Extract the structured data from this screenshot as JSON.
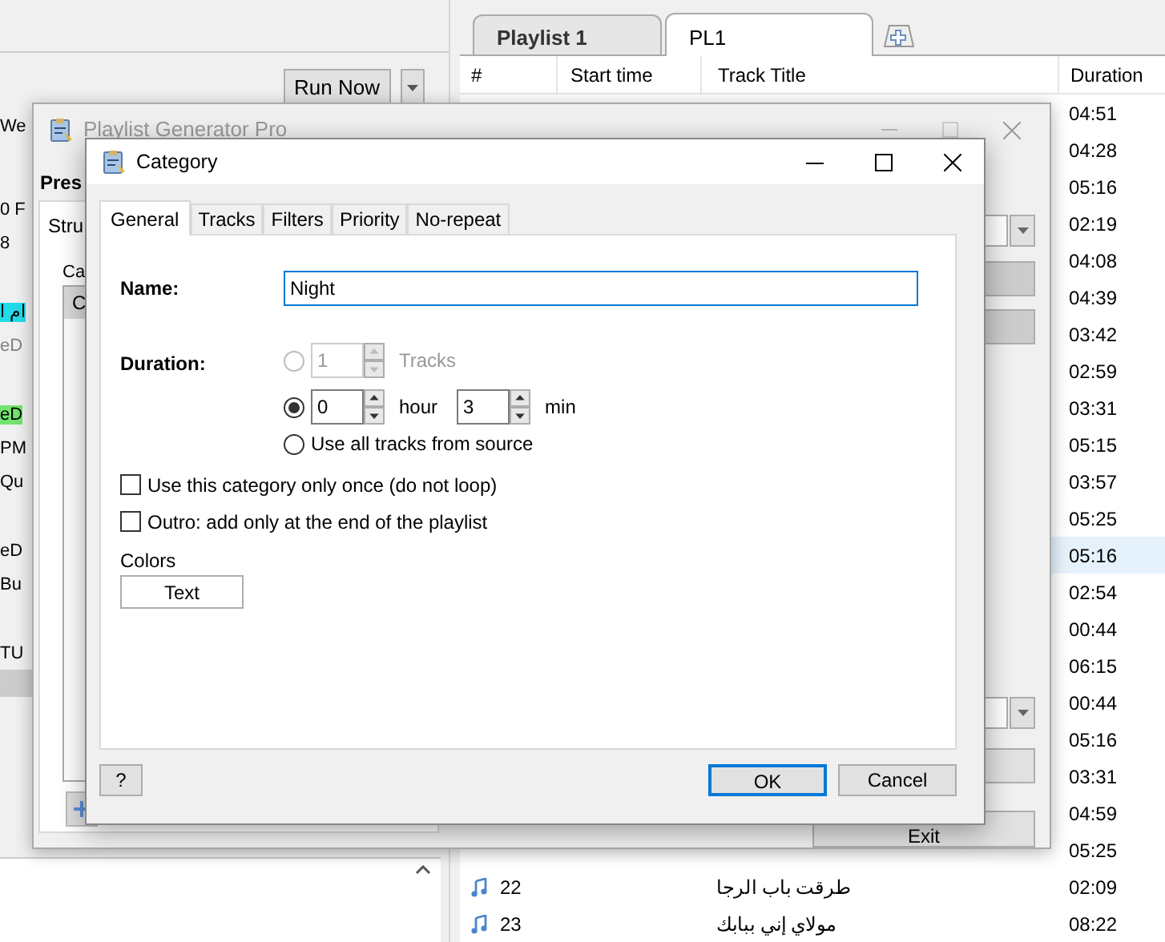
{
  "background": {
    "run_button": "Run Now",
    "left_top_text": "We",
    "left_rows": [
      {
        "kind": "text",
        "text": "0 F",
        "dimmed": false
      },
      {
        "kind": "text",
        "text": "8",
        "dimmed": false
      },
      {
        "kind": "blank"
      },
      {
        "kind": "text",
        "text": "ام ا",
        "dimmed": false,
        "color": "#22dbe8"
      },
      {
        "kind": "text",
        "text": "eD",
        "dimmed": true
      },
      {
        "kind": "blank"
      },
      {
        "kind": "text",
        "text": "eD",
        "dimmed": false,
        "color": "#72e36f"
      },
      {
        "kind": "text",
        "text": "PM",
        "dimmed": false
      },
      {
        "kind": "text",
        "text": "Qu",
        "dimmed": false
      },
      {
        "kind": "blank"
      },
      {
        "kind": "text",
        "text": "eD",
        "dimmed": false
      },
      {
        "kind": "text",
        "text": "Bu",
        "dimmed": false
      },
      {
        "kind": "blank"
      },
      {
        "kind": "text",
        "text": "TU",
        "dimmed": false
      }
    ],
    "playlist_tabs": [
      {
        "label": "Playlist 1",
        "selected": false
      },
      {
        "label": "PL1",
        "selected": true
      }
    ],
    "table": {
      "columns": [
        "#",
        "Start time",
        "Track Title",
        "Duration"
      ],
      "rows": [
        {
          "duration": "04:51",
          "selected": false
        },
        {
          "duration": "04:28",
          "selected": false
        },
        {
          "duration": "05:16",
          "selected": false
        },
        {
          "duration": "02:19",
          "selected": false
        },
        {
          "duration": "04:08",
          "selected": false
        },
        {
          "duration": "04:39",
          "selected": false
        },
        {
          "duration": "03:42",
          "selected": false
        },
        {
          "duration": "02:59",
          "selected": false
        },
        {
          "duration": "03:31",
          "selected": false
        },
        {
          "duration": "05:15",
          "selected": false
        },
        {
          "duration": "03:57",
          "selected": false
        },
        {
          "duration": "05:25",
          "selected": false
        },
        {
          "duration": "05:16",
          "selected": true
        },
        {
          "duration": "02:54",
          "selected": false
        },
        {
          "duration": "00:44",
          "selected": false
        },
        {
          "duration": "06:15",
          "selected": false
        },
        {
          "duration": "00:44",
          "selected": false
        },
        {
          "duration": "05:16",
          "selected": false
        },
        {
          "duration": "03:31",
          "selected": false
        },
        {
          "duration": "04:59",
          "selected": false
        },
        {
          "duration": "05:25",
          "selected": false
        },
        {
          "number": "22",
          "title": "طرقت باب الرجا",
          "duration": "02:09",
          "selected": false
        },
        {
          "number": "23",
          "title": "مولاي إني ببابك",
          "duration": "08:22",
          "selected": false
        }
      ]
    }
  },
  "generator_window": {
    "title": "Playlist Generator Pro",
    "presets_label": "Pres",
    "tab": "Stru",
    "list_label": "Ca",
    "list_items": [
      {
        "text": "C",
        "selected": true
      }
    ],
    "exit_button": "Exit"
  },
  "dialog": {
    "title": "Category",
    "tabs": [
      {
        "label": "General",
        "selected": true
      },
      {
        "label": "Tracks",
        "selected": false
      },
      {
        "label": "Filters",
        "selected": false
      },
      {
        "label": "Priority",
        "selected": false
      },
      {
        "label": "No-repeat",
        "selected": false
      }
    ],
    "name_label": "Name:",
    "name_value": "Night",
    "duration_label": "Duration:",
    "duration_options": [
      {
        "kind": "tracks",
        "selected": false,
        "disabled": true,
        "value": "1",
        "unit": "Tracks"
      },
      {
        "kind": "time",
        "selected": true,
        "disabled": false,
        "hours": "0",
        "hour_unit": "hour",
        "minutes": "3",
        "minute_unit": "min"
      },
      {
        "kind": "all",
        "selected": false,
        "disabled": false,
        "label": "Use all tracks from source"
      }
    ],
    "checkboxes": [
      {
        "label": "Use this category only once (do not loop)",
        "checked": false
      },
      {
        "label": "Outro: add only at the end of the playlist",
        "checked": false
      }
    ],
    "colors_label": "Colors",
    "color_button": "Text",
    "buttons": [
      {
        "kind": "help",
        "label": "?"
      },
      {
        "kind": "default",
        "label": "OK"
      },
      {
        "kind": "normal",
        "label": "Cancel"
      }
    ]
  }
}
